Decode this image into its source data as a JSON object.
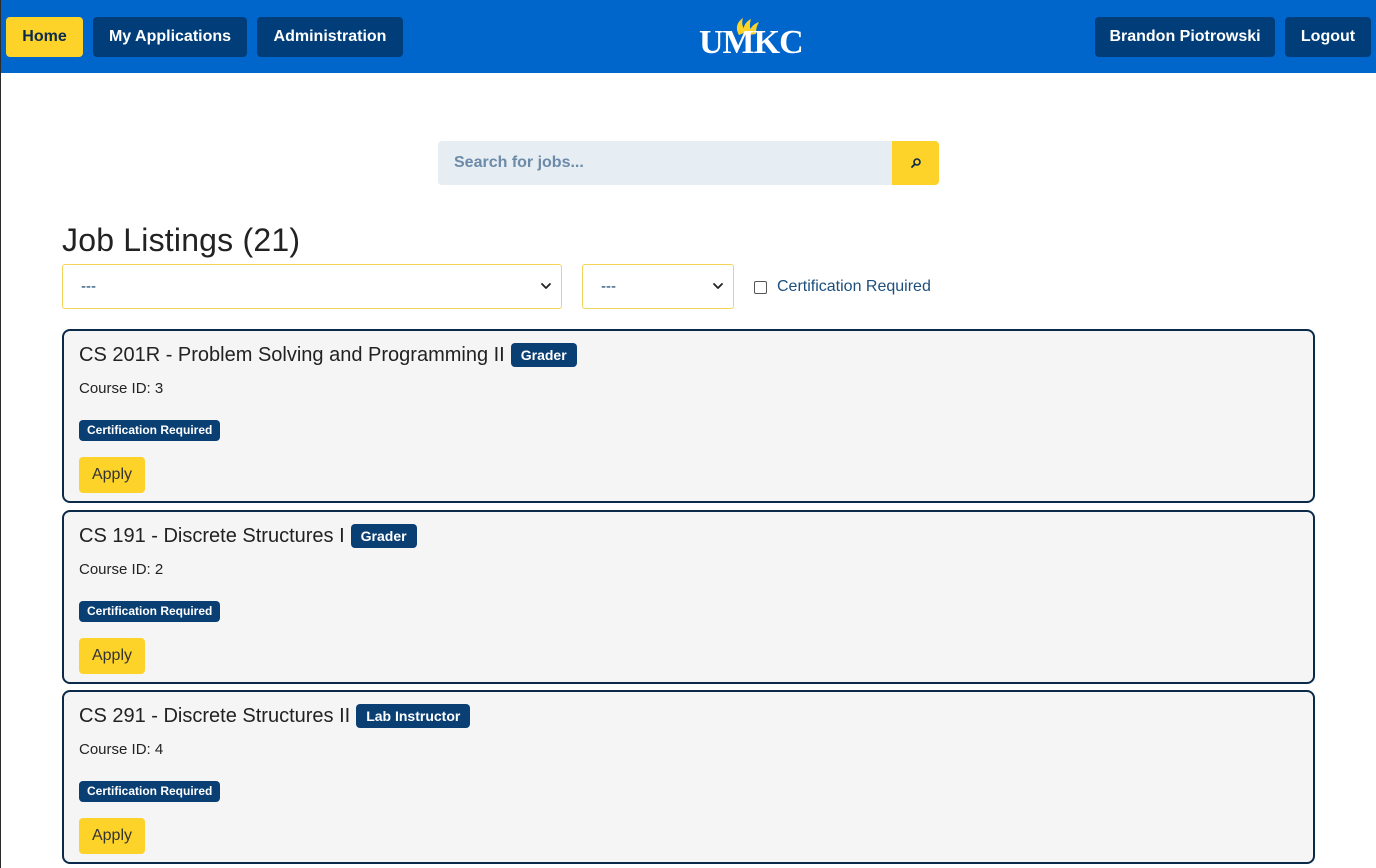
{
  "navbar": {
    "home_label": "Home",
    "applications_label": "My Applications",
    "administration_label": "Administration",
    "logo_text": "UMKC",
    "user_name": "Brandon Piotrowski",
    "logout_label": "Logout"
  },
  "search": {
    "placeholder": "Search for jobs...",
    "value": "",
    "icon": "search-icon"
  },
  "listings": {
    "title": "Job Listings (21)",
    "filter_select_1": "---",
    "filter_select_2": "---",
    "cert_filter_label": "Certification Required",
    "cert_filter_checked": false
  },
  "jobs": [
    {
      "title": "CS 201R - Problem Solving and Programming II",
      "role": "Grader",
      "course_id": "Course ID: 3",
      "cert_badge": "Certification Required",
      "apply_label": "Apply"
    },
    {
      "title": "CS 191 - Discrete Structures I",
      "role": "Grader",
      "course_id": "Course ID: 2",
      "cert_badge": "Certification Required",
      "apply_label": "Apply"
    },
    {
      "title": "CS 291 - Discrete Structures II",
      "role": "Lab Instructor",
      "course_id": "Course ID: 4",
      "cert_badge": "Certification Required",
      "apply_label": "Apply"
    }
  ],
  "colors": {
    "navbar_bg": "#0066cc",
    "nav_button_bg": "#013d78",
    "accent_yellow": "#fdd32a",
    "badge_bg": "#0a3f73",
    "card_border": "#0b2a4a",
    "card_bg": "#f5f5f5"
  }
}
